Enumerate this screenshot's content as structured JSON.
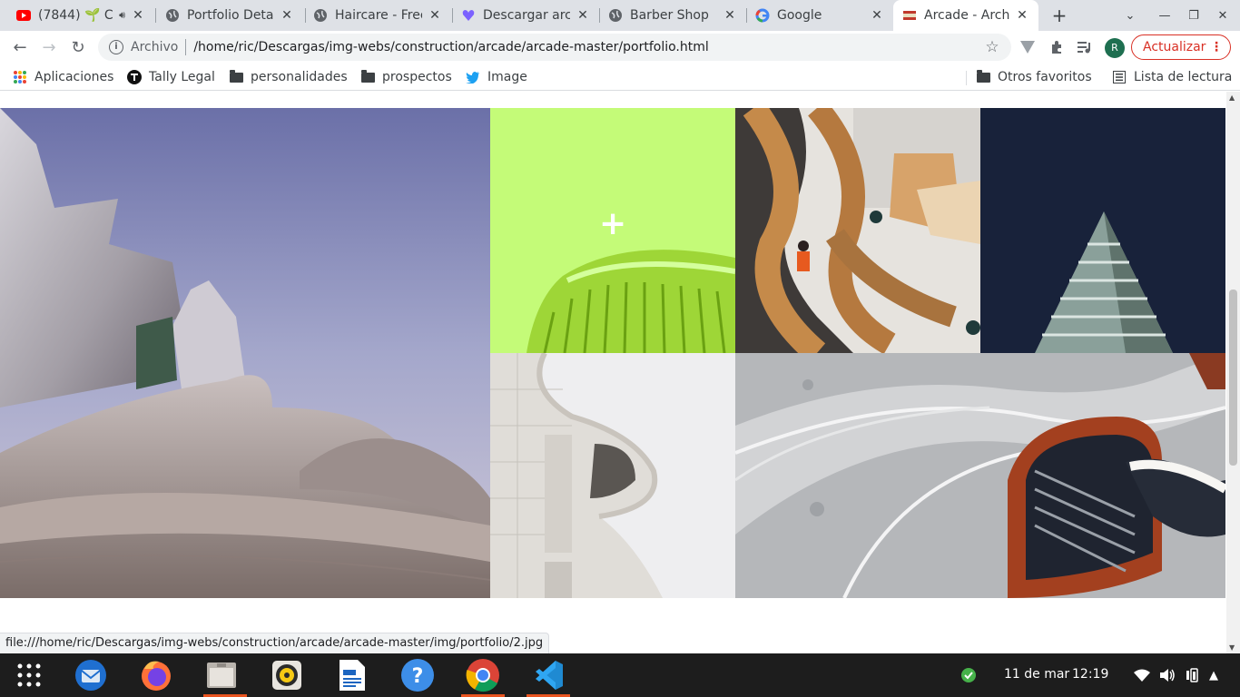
{
  "tabs": [
    {
      "title": "(7844) 🌱 C",
      "icon": "youtube-icon",
      "audio": true
    },
    {
      "title": "Portfolio Deta",
      "icon": "globe-icon"
    },
    {
      "title": "Haircare - Free",
      "icon": "globe-icon"
    },
    {
      "title": "Descargar arc",
      "icon": "heart-icon"
    },
    {
      "title": "Barber Shop",
      "icon": "globe-icon"
    },
    {
      "title": "Google",
      "icon": "google-icon"
    },
    {
      "title": "Arcade - Archi",
      "icon": "site-icon",
      "active": true
    }
  ],
  "omnibox": {
    "scheme": "Archivo",
    "url": "/home/ric/Descargas/img-webs/construction/arcade/arcade-master/portfolio.html"
  },
  "toolbar": {
    "update_label": "Actualizar",
    "avatar_letter": "R"
  },
  "bookmarks": [
    {
      "label": "Aplicaciones",
      "icon": "apps-grid-icon"
    },
    {
      "label": "Tally Legal",
      "icon": "tally-icon"
    },
    {
      "label": "personalidades",
      "icon": "folder-icon"
    },
    {
      "label": "prospectos",
      "icon": "folder-icon"
    },
    {
      "label": "Image",
      "icon": "twitter-icon"
    }
  ],
  "bookmarks_right": [
    {
      "label": "Otros favoritos",
      "icon": "folder-icon"
    },
    {
      "label": "Lista de lectura",
      "icon": "reading-list-icon"
    }
  ],
  "portfolio": {
    "hover_symbol": "+",
    "tiles": [
      {
        "name": "concert-hall-tile",
        "colors": [
          "#6e75a8",
          "#9aa0c8",
          "#c8c6d6"
        ]
      },
      {
        "name": "green-building-tile",
        "colors": [
          "#c4fb78",
          "#8ccb1e"
        ]
      },
      {
        "name": "spiral-staircase-tile",
        "colors": [
          "#b37a45",
          "#e7e4df"
        ]
      },
      {
        "name": "dark-triangle-building-tile",
        "colors": [
          "#18223a",
          "#9fb1ad"
        ]
      },
      {
        "name": "white-curved-building-tile",
        "colors": [
          "#eeeef0",
          "#d9d6d1"
        ]
      },
      {
        "name": "red-spiral-stair-tile",
        "colors": [
          "#a94226",
          "#b9bbbe"
        ]
      }
    ]
  },
  "status_bar": {
    "link": "file:///home/ric/Descargas/img-webs/construction/arcade/arcade-master/img/portfolio/2.jpg"
  },
  "taskbar": {
    "date": "11 de mar",
    "time": "12:19",
    "apps": [
      "app-grid-icon",
      "thunderbird-icon",
      "firefox-icon",
      "files-icon",
      "rhythmbox-icon",
      "writer-icon",
      "help-icon",
      "chrome-icon",
      "vscode-icon"
    ]
  }
}
